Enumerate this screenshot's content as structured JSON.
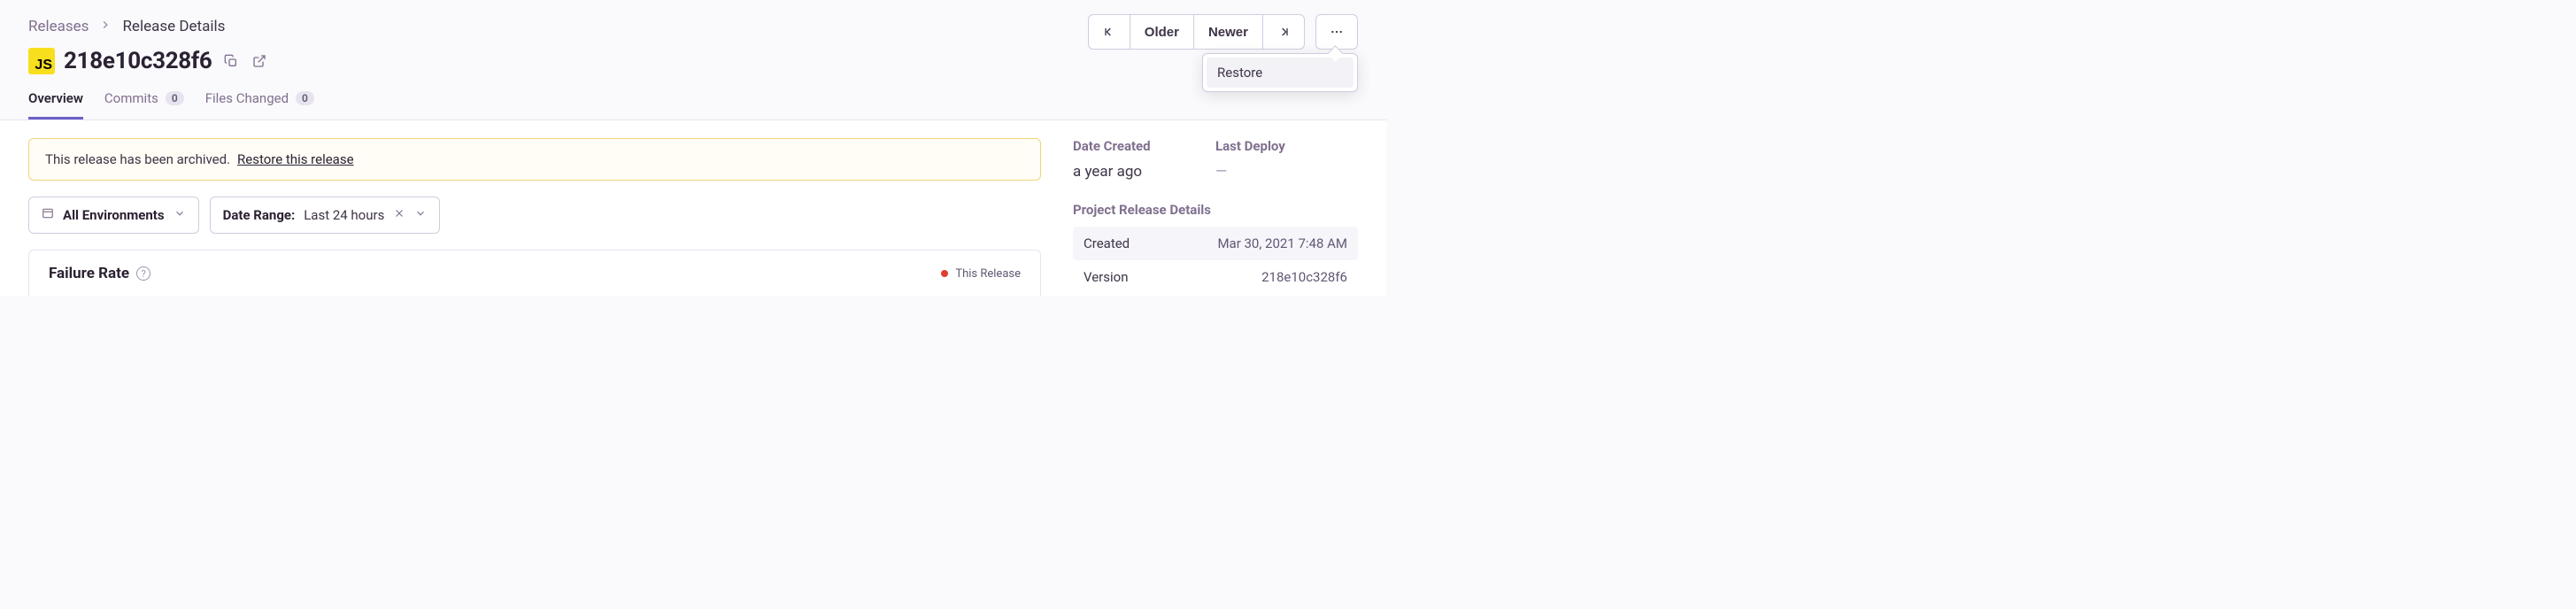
{
  "breadcrumb": {
    "parent": "Releases",
    "current": "Release Details"
  },
  "release": {
    "platform_badge": "JS",
    "version": "218e10c328f6"
  },
  "nav": {
    "older": "Older",
    "newer": "Newer"
  },
  "dropdown": {
    "restore": "Restore"
  },
  "tabs": {
    "overview": "Overview",
    "commits": {
      "label": "Commits",
      "count": "0"
    },
    "files_changed": {
      "label": "Files Changed",
      "count": "0"
    }
  },
  "alert": {
    "message": "This release has been archived.",
    "action": "Restore this release"
  },
  "filters": {
    "environments": "All Environments",
    "date_range_label": "Date Range:",
    "date_range_value": "Last 24 hours"
  },
  "panel": {
    "title": "Failure Rate",
    "legend": "This Release"
  },
  "sidebar": {
    "date_created_label": "Date Created",
    "date_created_value": "a year ago",
    "last_deploy_label": "Last Deploy",
    "last_deploy_value": "—",
    "project_details_heading": "Project Release Details",
    "rows": {
      "created": {
        "key": "Created",
        "val": "Mar 30, 2021 7:48 AM"
      },
      "version": {
        "key": "Version",
        "val": "218e10c328f6"
      }
    }
  }
}
